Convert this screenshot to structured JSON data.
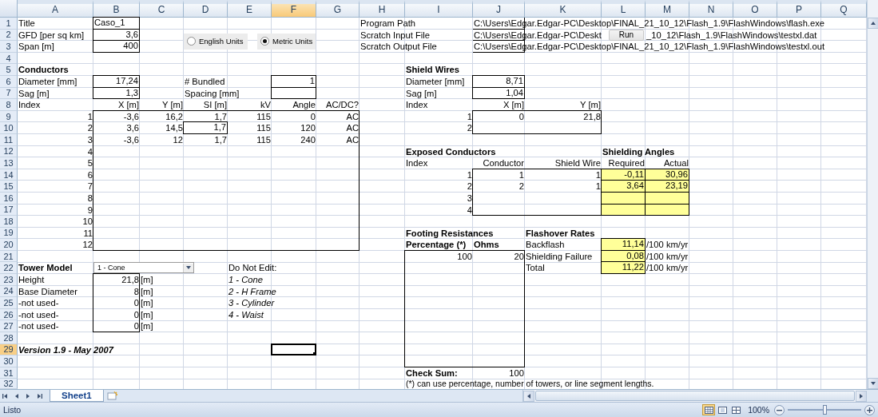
{
  "columns": [
    {
      "label": "A",
      "selected": false
    },
    {
      "label": "B",
      "selected": false
    },
    {
      "label": "C",
      "selected": false
    },
    {
      "label": "D",
      "selected": false
    },
    {
      "label": "E",
      "selected": false
    },
    {
      "label": "F",
      "selected": true
    },
    {
      "label": "G",
      "selected": false
    },
    {
      "label": "H",
      "selected": false
    },
    {
      "label": "I",
      "selected": false
    },
    {
      "label": "J",
      "selected": false
    },
    {
      "label": "K",
      "selected": false
    },
    {
      "label": "L",
      "selected": false
    },
    {
      "label": "M",
      "selected": false
    },
    {
      "label": "N",
      "selected": false
    },
    {
      "label": "O",
      "selected": false
    },
    {
      "label": "P",
      "selected": false
    },
    {
      "label": "Q",
      "selected": false
    }
  ],
  "rows": [
    {
      "label": "1",
      "selected": false,
      "cells": {
        "A": {
          "text": "Title",
          "kind": "label"
        },
        "B": {
          "text": "Caso_1",
          "kind": "label"
        },
        "H": {
          "text": "Program Path",
          "kind": "label"
        },
        "J": {
          "text": "C:\\Users\\Edgar.Edgar-PC\\Desktop\\FINAL_21_10_12\\Flash_1.9\\FlashWindows\\flash.exe",
          "kind": "label"
        }
      }
    },
    {
      "label": "2",
      "selected": false,
      "cells": {
        "A": {
          "text": "GFD [per sq km]",
          "kind": "label"
        },
        "B": {
          "text": "3,6",
          "kind": "value"
        },
        "H": {
          "text": "Scratch Input File",
          "kind": "label"
        },
        "J": {
          "text": "C:\\Users\\Edgar.Edgar-PC\\Deskt",
          "kind": "label"
        },
        "M": {
          "text": "_10_12\\Flash_1.9\\FlashWindows\\testxl.dat",
          "kind": "label"
        }
      }
    },
    {
      "label": "3",
      "selected": false,
      "cells": {
        "A": {
          "text": "Span [m]",
          "kind": "label"
        },
        "B": {
          "text": "400",
          "kind": "value"
        },
        "H": {
          "text": "Scratch Output File",
          "kind": "label"
        },
        "J": {
          "text": "C:\\Users\\Edgar.Edgar-PC\\Desktop\\FINAL_21_10_12\\Flash_1.9\\FlashWindows\\testxl.out",
          "kind": "label"
        }
      }
    },
    {
      "label": "4",
      "selected": false,
      "cells": {}
    },
    {
      "label": "5",
      "selected": false,
      "cells": {
        "A": {
          "text": "Conductors",
          "kind": "heading"
        },
        "I": {
          "text": "Shield Wires",
          "kind": "heading"
        }
      }
    },
    {
      "label": "6",
      "selected": false,
      "cells": {
        "A": {
          "text": "Diameter [mm]",
          "kind": "label"
        },
        "B": {
          "text": "17,24",
          "kind": "value"
        },
        "D": {
          "text": "# Bundled",
          "kind": "label"
        },
        "F": {
          "text": "1",
          "kind": "value"
        },
        "I": {
          "text": "Diameter [mm]",
          "kind": "label"
        },
        "J": {
          "text": "8,71",
          "kind": "value"
        }
      }
    },
    {
      "label": "7",
      "selected": false,
      "cells": {
        "A": {
          "text": "Sag [m]",
          "kind": "label"
        },
        "B": {
          "text": "1,3",
          "kind": "value"
        },
        "D": {
          "text": "Spacing [mm]",
          "kind": "label"
        },
        "I": {
          "text": "Sag [m]",
          "kind": "label"
        },
        "J": {
          "text": "1,04",
          "kind": "value"
        }
      }
    },
    {
      "label": "8",
      "selected": false,
      "cells": {
        "A": {
          "text": "Index",
          "kind": "label"
        },
        "B": {
          "text": "X [m]",
          "kind": "value"
        },
        "C": {
          "text": "Y [m]",
          "kind": "value"
        },
        "D": {
          "text": "SI [m]",
          "kind": "value"
        },
        "E": {
          "text": "kV",
          "kind": "value"
        },
        "F": {
          "text": "Angle",
          "kind": "value"
        },
        "G": {
          "text": "AC/DC?",
          "kind": "value"
        },
        "I": {
          "text": "Index",
          "kind": "label"
        },
        "J": {
          "text": "X [m]",
          "kind": "value"
        },
        "K": {
          "text": "Y [m]",
          "kind": "value"
        }
      }
    },
    {
      "label": "9",
      "selected": false,
      "cells": {
        "A": {
          "text": "1",
          "kind": "value"
        },
        "B": {
          "text": "-3,6",
          "kind": "value"
        },
        "C": {
          "text": "16,2",
          "kind": "value"
        },
        "D": {
          "text": "1,7",
          "kind": "value"
        },
        "E": {
          "text": "115",
          "kind": "value"
        },
        "F": {
          "text": "0",
          "kind": "value"
        },
        "G": {
          "text": "AC",
          "kind": "value"
        },
        "I": {
          "text": "1",
          "kind": "value"
        },
        "J": {
          "text": "0",
          "kind": "value"
        },
        "K": {
          "text": "21,8",
          "kind": "value"
        }
      }
    },
    {
      "label": "10",
      "selected": false,
      "cells": {
        "A": {
          "text": "2",
          "kind": "value"
        },
        "B": {
          "text": "3,6",
          "kind": "value"
        },
        "C": {
          "text": "14,5",
          "kind": "value"
        },
        "D": {
          "text": "1,7",
          "kind": "value"
        },
        "E": {
          "text": "115",
          "kind": "value"
        },
        "F": {
          "text": "120",
          "kind": "value"
        },
        "G": {
          "text": "AC",
          "kind": "value"
        },
        "I": {
          "text": "2",
          "kind": "value"
        }
      }
    },
    {
      "label": "11",
      "selected": false,
      "cells": {
        "A": {
          "text": "3",
          "kind": "value"
        },
        "B": {
          "text": "-3,6",
          "kind": "value"
        },
        "C": {
          "text": "12",
          "kind": "value"
        },
        "D": {
          "text": "1,7",
          "kind": "value"
        },
        "E": {
          "text": "115",
          "kind": "value"
        },
        "F": {
          "text": "240",
          "kind": "value"
        },
        "G": {
          "text": "AC",
          "kind": "value"
        }
      }
    },
    {
      "label": "12",
      "selected": false,
      "cells": {
        "A": {
          "text": "4",
          "kind": "value"
        },
        "I": {
          "text": "Exposed Conductors",
          "kind": "heading"
        },
        "L": {
          "text": "Shielding Angles",
          "kind": "heading"
        }
      }
    },
    {
      "label": "13",
      "selected": false,
      "cells": {
        "A": {
          "text": "5",
          "kind": "value"
        },
        "I": {
          "text": "Index",
          "kind": "label"
        },
        "J": {
          "text": "Conductor",
          "kind": "value"
        },
        "K": {
          "text": "Shield Wire",
          "kind": "value"
        },
        "L": {
          "text": "Required",
          "kind": "value"
        },
        "M": {
          "text": "Actual",
          "kind": "value"
        }
      }
    },
    {
      "label": "14",
      "selected": false,
      "cells": {
        "A": {
          "text": "6",
          "kind": "value"
        },
        "I": {
          "text": "1",
          "kind": "value"
        },
        "J": {
          "text": "1",
          "kind": "value"
        },
        "K": {
          "text": "1",
          "kind": "value"
        },
        "L": {
          "text": "-0,11",
          "kind": "result"
        },
        "M": {
          "text": "30,96",
          "kind": "result"
        }
      }
    },
    {
      "label": "15",
      "selected": false,
      "cells": {
        "A": {
          "text": "7",
          "kind": "value"
        },
        "I": {
          "text": "2",
          "kind": "value"
        },
        "J": {
          "text": "2",
          "kind": "value"
        },
        "K": {
          "text": "1",
          "kind": "value"
        },
        "L": {
          "text": "3,64",
          "kind": "result"
        },
        "M": {
          "text": "23,19",
          "kind": "result"
        }
      }
    },
    {
      "label": "16",
      "selected": false,
      "cells": {
        "A": {
          "text": "8",
          "kind": "value"
        },
        "I": {
          "text": "3",
          "kind": "value"
        },
        "L": {
          "kind": "result"
        },
        "M": {
          "kind": "result"
        }
      }
    },
    {
      "label": "17",
      "selected": false,
      "cells": {
        "A": {
          "text": "9",
          "kind": "value"
        },
        "I": {
          "text": "4",
          "kind": "value"
        },
        "L": {
          "kind": "result"
        },
        "M": {
          "kind": "result"
        }
      }
    },
    {
      "label": "18",
      "selected": false,
      "cells": {
        "A": {
          "text": "10",
          "kind": "value"
        }
      }
    },
    {
      "label": "19",
      "selected": false,
      "cells": {
        "A": {
          "text": "11",
          "kind": "value"
        },
        "I": {
          "text": "Footing Resistances",
          "kind": "heading"
        },
        "K": {
          "text": "Flashover Rates",
          "kind": "heading"
        }
      }
    },
    {
      "label": "20",
      "selected": false,
      "cells": {
        "A": {
          "text": "12",
          "kind": "value"
        },
        "I": {
          "text": "Percentage (*)",
          "kind": "heading"
        },
        "J": {
          "text": "Ohms",
          "kind": "heading"
        },
        "K": {
          "text": "Backflash",
          "kind": "label"
        },
        "L": {
          "text": "11,14",
          "kind": "result"
        },
        "M": {
          "text": "/100 km/yr",
          "kind": "label"
        }
      }
    },
    {
      "label": "21",
      "selected": false,
      "cells": {
        "I": {
          "text": "100",
          "kind": "value"
        },
        "J": {
          "text": "20",
          "kind": "value"
        },
        "K": {
          "text": "Shielding Failure",
          "kind": "label"
        },
        "L": {
          "text": "0,08",
          "kind": "result"
        },
        "M": {
          "text": "/100 km/yr",
          "kind": "label"
        }
      }
    },
    {
      "label": "22",
      "selected": false,
      "cells": {
        "A": {
          "text": "Tower Model",
          "kind": "heading"
        },
        "E": {
          "text": "Do Not Edit:",
          "kind": "label"
        },
        "K": {
          "text": "Total",
          "kind": "label"
        },
        "L": {
          "text": "11,22",
          "kind": "result"
        },
        "M": {
          "text": "/100 km/yr",
          "kind": "label"
        }
      }
    },
    {
      "label": "23",
      "selected": false,
      "cells": {
        "A": {
          "text": "Height",
          "kind": "label"
        },
        "B": {
          "text": "21,8",
          "kind": "value"
        },
        "C": {
          "text": "[m]",
          "kind": "label"
        },
        "E": {
          "text": "1 - Cone",
          "kind": "option"
        }
      }
    },
    {
      "label": "24",
      "selected": false,
      "cells": {
        "A": {
          "text": "Base Diameter",
          "kind": "label"
        },
        "B": {
          "text": "8",
          "kind": "value"
        },
        "C": {
          "text": "[m]",
          "kind": "label"
        },
        "E": {
          "text": "2 - H Frame",
          "kind": "option"
        }
      }
    },
    {
      "label": "25",
      "selected": false,
      "cells": {
        "A": {
          "text": "-not used-",
          "kind": "label"
        },
        "B": {
          "text": "0",
          "kind": "value"
        },
        "C": {
          "text": "[m]",
          "kind": "label"
        },
        "E": {
          "text": "3 - Cylinder",
          "kind": "option"
        }
      }
    },
    {
      "label": "26",
      "selected": false,
      "cells": {
        "A": {
          "text": "-not used-",
          "kind": "label"
        },
        "B": {
          "text": "0",
          "kind": "value"
        },
        "C": {
          "text": "[m]",
          "kind": "label"
        },
        "E": {
          "text": "4 - Waist",
          "kind": "option"
        }
      }
    },
    {
      "label": "27",
      "selected": false,
      "cells": {
        "A": {
          "text": "-not used-",
          "kind": "label"
        },
        "B": {
          "text": "0",
          "kind": "value"
        },
        "C": {
          "text": "[m]",
          "kind": "label"
        }
      }
    },
    {
      "label": "28",
      "selected": false,
      "cells": {}
    },
    {
      "label": "29",
      "selected": true,
      "cells": {
        "A": {
          "text": "Version 1.9 - May 2007",
          "kind": "caption"
        },
        "F": {
          "kind": "active"
        }
      }
    },
    {
      "label": "30",
      "selected": false,
      "cells": {}
    },
    {
      "label": "31",
      "selected": false,
      "cells": {
        "I": {
          "text": "Check Sum:",
          "kind": "heading"
        },
        "J": {
          "text": "100",
          "kind": "value"
        }
      }
    },
    {
      "label": "32",
      "selected": false,
      "cells": {
        "I": {
          "text": "(*) can use percentage, number of towers, or line segment lengths.",
          "kind": "label"
        }
      }
    }
  ],
  "units": [
    {
      "label": "English Units",
      "selected": false
    },
    {
      "label": "Metric Units",
      "selected": true
    }
  ],
  "run_button": {
    "label": "Run"
  },
  "tower_model_select": {
    "value": "1 - Cone"
  },
  "sheet_tabs": [
    {
      "label": "Sheet1",
      "selected": true
    }
  ],
  "status_bar": {
    "text": "Listo",
    "views": [
      {
        "selected": true
      },
      {
        "selected": false
      },
      {
        "selected": false
      }
    ],
    "zoom": "100%",
    "zoom_slider": {
      "level": 0.5
    }
  }
}
